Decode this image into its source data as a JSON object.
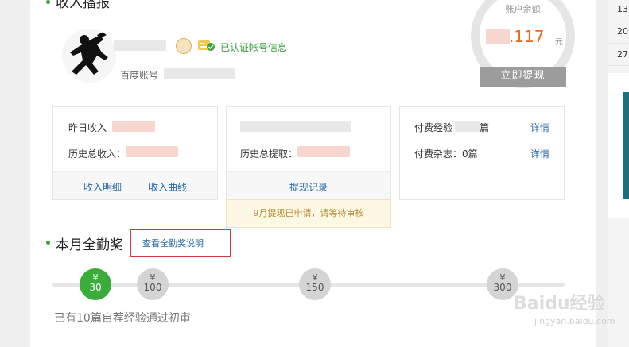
{
  "header": {
    "title": "收入播报"
  },
  "profile": {
    "verified_text": "已认证帐号信息",
    "account_label": "百度账号"
  },
  "balance": {
    "label": "账户余额",
    "value": ".117",
    "unit": "元",
    "withdraw_label": "立即提现"
  },
  "income_card": {
    "yesterday_label": "昨日收入",
    "total_label": "历史总收入：",
    "detail_link": "收入明细",
    "curve_link": "收入曲线"
  },
  "withdraw_card": {
    "total_label": "历史总提取：",
    "record_link": "提现记录",
    "notice": "9月提现已申请，请等待审核"
  },
  "paid_card": {
    "experience_label": "付费经验",
    "experience_suffix": "篇",
    "experience_link": "详情",
    "magazine_label": "付费杂志：0篇",
    "magazine_link": "详情"
  },
  "attendance": {
    "title": "本月全勤奖",
    "explain_link": "查看全勤奖说明",
    "currency_symbol": "¥",
    "milestones": [
      "30",
      "100",
      "150",
      "300"
    ],
    "active_milestones": 1,
    "status": "已有10篇自荐经验通过初审"
  },
  "right_panel": {
    "rows": [
      "13",
      "20",
      "27"
    ]
  },
  "watermark": {
    "brand": "Baidu经验",
    "url": "jingyan.baidu.com"
  },
  "colors": {
    "green": "#3aac3a",
    "orange": "#e56a1c",
    "link": "#2b6aa7",
    "highlight": "#d33a3a"
  }
}
